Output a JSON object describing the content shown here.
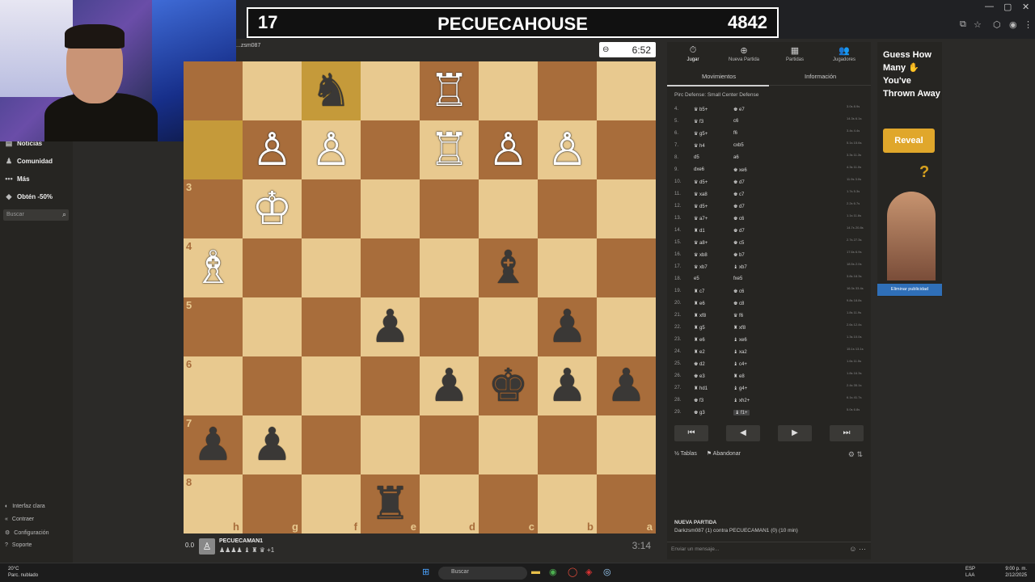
{
  "banner": {
    "left": "17",
    "title": "PECUECAHOUSE",
    "right": "4842"
  },
  "sidebar": {
    "items": [
      {
        "label": "Noticias",
        "icon": "news-icon",
        "glyph": "▤"
      },
      {
        "label": "Comunidad",
        "icon": "community-icon",
        "glyph": "♟"
      },
      {
        "label": "Más",
        "icon": "more-icon",
        "glyph": "•••"
      },
      {
        "label": "Obtén -50%",
        "icon": "diamond-icon",
        "glyph": "◆"
      }
    ],
    "search_placeholder": "Buscar",
    "bottom": [
      {
        "label": "Interfaz clara",
        "icon": "contrast-icon",
        "glyph": "◐"
      },
      {
        "label": "Contraer",
        "icon": "collapse-icon",
        "glyph": "«"
      },
      {
        "label": "Configuración",
        "icon": "settings-icon",
        "glyph": "⚙"
      },
      {
        "label": "Soporte",
        "icon": "help-icon",
        "glyph": "?"
      }
    ]
  },
  "opponent": {
    "name": "...zsm087"
  },
  "clock_top": "6:52",
  "clock_bottom": "3:14",
  "me": {
    "score": "0.0",
    "name": "PECUECAMAN1",
    "captures": "♟♟♟♟ ♝ ♜ ♛ +1"
  },
  "board": {
    "ranks": [
      "",
      "",
      "3",
      "4",
      "5",
      "6",
      "7",
      "8"
    ],
    "files": [
      "h",
      "g",
      "f",
      "e",
      "d",
      "c",
      "b",
      "a"
    ],
    "highlight": [
      [
        0,
        2
      ],
      [
        1,
        0
      ]
    ],
    "pieces": [
      {
        "r": 0,
        "c": 2,
        "g": "♞",
        "side": "b"
      },
      {
        "r": 0,
        "c": 4,
        "g": "♖",
        "side": "w"
      },
      {
        "r": 1,
        "c": 1,
        "g": "♙",
        "side": "w"
      },
      {
        "r": 1,
        "c": 2,
        "g": "♙",
        "side": "w"
      },
      {
        "r": 1,
        "c": 4,
        "g": "♖",
        "side": "w"
      },
      {
        "r": 1,
        "c": 5,
        "g": "♙",
        "side": "w"
      },
      {
        "r": 1,
        "c": 6,
        "g": "♙",
        "side": "w"
      },
      {
        "r": 2,
        "c": 1,
        "g": "♔",
        "side": "w"
      },
      {
        "r": 3,
        "c": 0,
        "g": "♗",
        "side": "w"
      },
      {
        "r": 3,
        "c": 5,
        "g": "♝",
        "side": "b"
      },
      {
        "r": 4,
        "c": 3,
        "g": "♟",
        "side": "b"
      },
      {
        "r": 4,
        "c": 6,
        "g": "♟",
        "side": "b"
      },
      {
        "r": 5,
        "c": 4,
        "g": "♟",
        "side": "b"
      },
      {
        "r": 5,
        "c": 5,
        "g": "♚",
        "side": "b"
      },
      {
        "r": 5,
        "c": 6,
        "g": "♟",
        "side": "b"
      },
      {
        "r": 5,
        "c": 7,
        "g": "♟",
        "side": "b"
      },
      {
        "r": 6,
        "c": 0,
        "g": "♟",
        "side": "b"
      },
      {
        "r": 6,
        "c": 1,
        "g": "♟",
        "side": "b"
      },
      {
        "r": 7,
        "c": 3,
        "g": "♜",
        "side": "b"
      }
    ]
  },
  "panel": {
    "nav": [
      {
        "label": "Jugar",
        "glyph": "⏱",
        "icon": "play-clock-icon",
        "active": true
      },
      {
        "label": "Nueva Partida",
        "glyph": "⊕",
        "icon": "new-game-icon"
      },
      {
        "label": "Partidas",
        "glyph": "▦",
        "icon": "games-icon"
      },
      {
        "label": "Jugadores",
        "glyph": "👥",
        "icon": "players-icon"
      }
    ],
    "tabs": [
      "Movimientos",
      "Información"
    ],
    "opening": "Pirc Defense: Small Center Defense",
    "moves": [
      {
        "n": "4.",
        "w": "♛ b5+",
        "b": "♚ e7",
        "t": "3.0s 8.9s"
      },
      {
        "n": "5.",
        "w": "♛ f3",
        "b": "c6",
        "t": "14.3s 6.1s"
      },
      {
        "n": "6.",
        "w": "♛ g5+",
        "b": "f6",
        "t": "3.4s 4.4s"
      },
      {
        "n": "7.",
        "w": "♛ h4",
        "b": "cxb5",
        "t": "5.1s 15.6s"
      },
      {
        "n": "8.",
        "w": "d5",
        "b": "a6",
        "t": "3.3s 11.3s"
      },
      {
        "n": "9.",
        "w": "dxe6",
        "b": "♚ xe6",
        "t": "4.3s 11.0s"
      },
      {
        "n": "10.",
        "w": "♛ d5+",
        "b": "♚ d7",
        "t": "11.9s 3.0s"
      },
      {
        "n": "11.",
        "w": "♛ xa8",
        "b": "♚ c7",
        "t": "1.7s 5.3s"
      },
      {
        "n": "12.",
        "w": "♛ d5+",
        "b": "♚ d7",
        "t": "2.2s 6.7s"
      },
      {
        "n": "13.",
        "w": "♛ a7+",
        "b": "♚ c6",
        "t": "1.1s 11.6s"
      },
      {
        "n": "14.",
        "w": "♜ d1",
        "b": "♚ d7",
        "t": "14.7s 20.8s"
      },
      {
        "n": "15.",
        "w": "♛ a8+",
        "b": "♚ c5",
        "t": "2.7s 27.3s"
      },
      {
        "n": "16.",
        "w": "♛ xb8",
        "b": "♚ b7",
        "t": "17.6s 6.9s"
      },
      {
        "n": "17.",
        "w": "♛ xb7",
        "b": "♝ xb7",
        "t": "18.5s 2.0s"
      },
      {
        "n": "18.",
        "w": "e5",
        "b": "fxe5",
        "t": "3.8s 18.3s"
      },
      {
        "n": "19.",
        "w": "♜ c7",
        "b": "♚ c6",
        "t": "16.3s 33.4s"
      },
      {
        "n": "20.",
        "w": "♜ e6",
        "b": "♚ c8",
        "t": "9.8s 18.8s"
      },
      {
        "n": "21.",
        "w": "♜ xf8",
        "b": "♛ f6",
        "t": "1.8s 11.9s"
      },
      {
        "n": "22.",
        "w": "♜ g5",
        "b": "♜ xf8",
        "t": "2.6s 12.4s"
      },
      {
        "n": "23.",
        "w": "♜ e6",
        "b": "♝ xe6",
        "t": "1.3s 10.0s"
      },
      {
        "n": "24.",
        "w": "♜ e2",
        "b": "♝ xa2",
        "t": "15.1s 13.1s"
      },
      {
        "n": "25.",
        "w": "♚ d2",
        "b": "♝ c4+",
        "t": "1.6s 11.5s"
      },
      {
        "n": "26.",
        "w": "♚ e3",
        "b": "♜ e8",
        "t": "1.8s 16.3s"
      },
      {
        "n": "27.",
        "w": "♜ hd1",
        "b": "♝ g4+",
        "t": "2.4s 35.1s"
      },
      {
        "n": "28.",
        "w": "♚ f3",
        "b": "♝ xh2+",
        "t": "6.1s 41.7s"
      },
      {
        "n": "29.",
        "w": "♚ g3",
        "b": "♝ f1+",
        "t": "5.0s 6.8s",
        "current": true
      }
    ],
    "controls": [
      "⏮",
      "◀",
      "▶",
      "⏭"
    ],
    "actions": [
      "½ Tablas",
      "⚑ Abandonar"
    ],
    "new_game_title": "NUEVA PARTIDA",
    "new_game_text": "Darkzsm087 (1) contra PECUECAMAN1 (0) (10 min)",
    "chat_placeholder": "Enviar un mensaje..."
  },
  "ad": {
    "headline": "Guess How Many ✋ You've Thrown Away",
    "button": "Reveal",
    "remove": "Eliminar publicidad"
  },
  "taskbar": {
    "temp": "20°C",
    "weather": "Parc. nublado",
    "search": "Buscar",
    "lang1": "ESP",
    "lang2": "LAA",
    "time": "9:00 p. m.",
    "date": "2/12/2025"
  }
}
